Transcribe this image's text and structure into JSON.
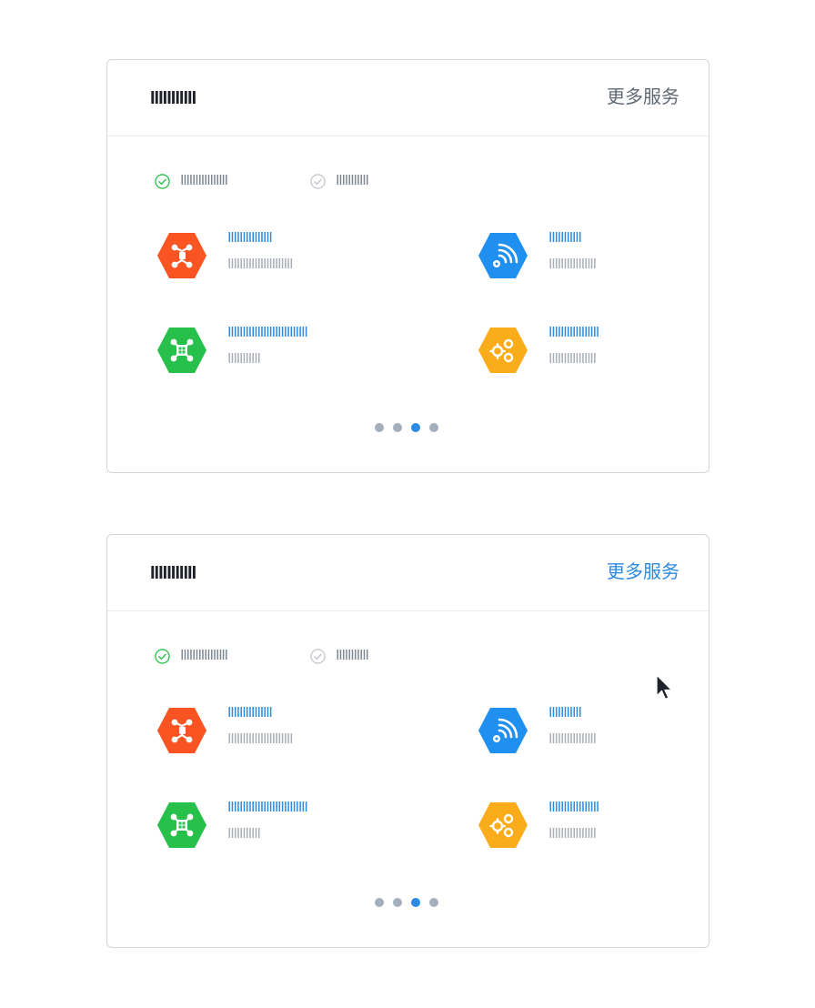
{
  "cards": [
    {
      "title": "IIIIIIIIIII",
      "more_label": "更多服务",
      "filters": [
        {
          "label": "IIIIIIIIIIIIIIII",
          "checked": true
        },
        {
          "label": "IIIIIIIIIII",
          "checked": false
        }
      ],
      "services": [
        {
          "name": "IIIIIIIIIIIIIII",
          "desc": "IIIIIIIIIIIIIIIIIIIIII",
          "color": "#fa5423",
          "icon": "puzzle-network-icon"
        },
        {
          "name": "IIIIIIIIIII",
          "desc": "IIIIIIIIIIIIIIII",
          "color": "#1f8ff0",
          "icon": "rss-gear-icon"
        },
        {
          "name": "IIIIIIIIIIIIIIIIIIIIIIIIIII",
          "desc": "IIIIIIIIIII",
          "color": "#27c04a",
          "icon": "grid-network-icon"
        },
        {
          "name": "IIIIIIIIIIIIIIIII",
          "desc": "IIIIIIIIIIIIIIII",
          "color": "#fbac1b",
          "icon": "gears-icon"
        }
      ],
      "pager": {
        "count": 4,
        "active": 2
      }
    },
    {
      "title": "IIIIIIIIIII",
      "more_label": "更多服务",
      "filters": [
        {
          "label": "IIIIIIIIIIIIIIII",
          "checked": true
        },
        {
          "label": "IIIIIIIIIII",
          "checked": false
        }
      ],
      "services": [
        {
          "name": "IIIIIIIIIIIIIII",
          "desc": "IIIIIIIIIIIIIIIIIIIIII",
          "color": "#fa5423",
          "icon": "puzzle-network-icon"
        },
        {
          "name": "IIIIIIIIIII",
          "desc": "IIIIIIIIIIIIIIII",
          "color": "#1f8ff0",
          "icon": "rss-gear-icon"
        },
        {
          "name": "IIIIIIIIIIIIIIIIIIIIIIIIIII",
          "desc": "IIIIIIIIIII",
          "color": "#27c04a",
          "icon": "grid-network-icon"
        },
        {
          "name": "IIIIIIIIIIIIIIIII",
          "desc": "IIIIIIIIIIIIIIII",
          "color": "#fbac1b",
          "icon": "gears-icon"
        }
      ],
      "pager": {
        "count": 4,
        "active": 2
      }
    }
  ],
  "colors": {
    "link_default": "#5f6873",
    "link_hover": "#2b8ae2",
    "check_active": "#27c04a",
    "check_inactive": "#c4c8cd",
    "dot": "#a4afbd",
    "dot_active": "#2b8ae2"
  }
}
